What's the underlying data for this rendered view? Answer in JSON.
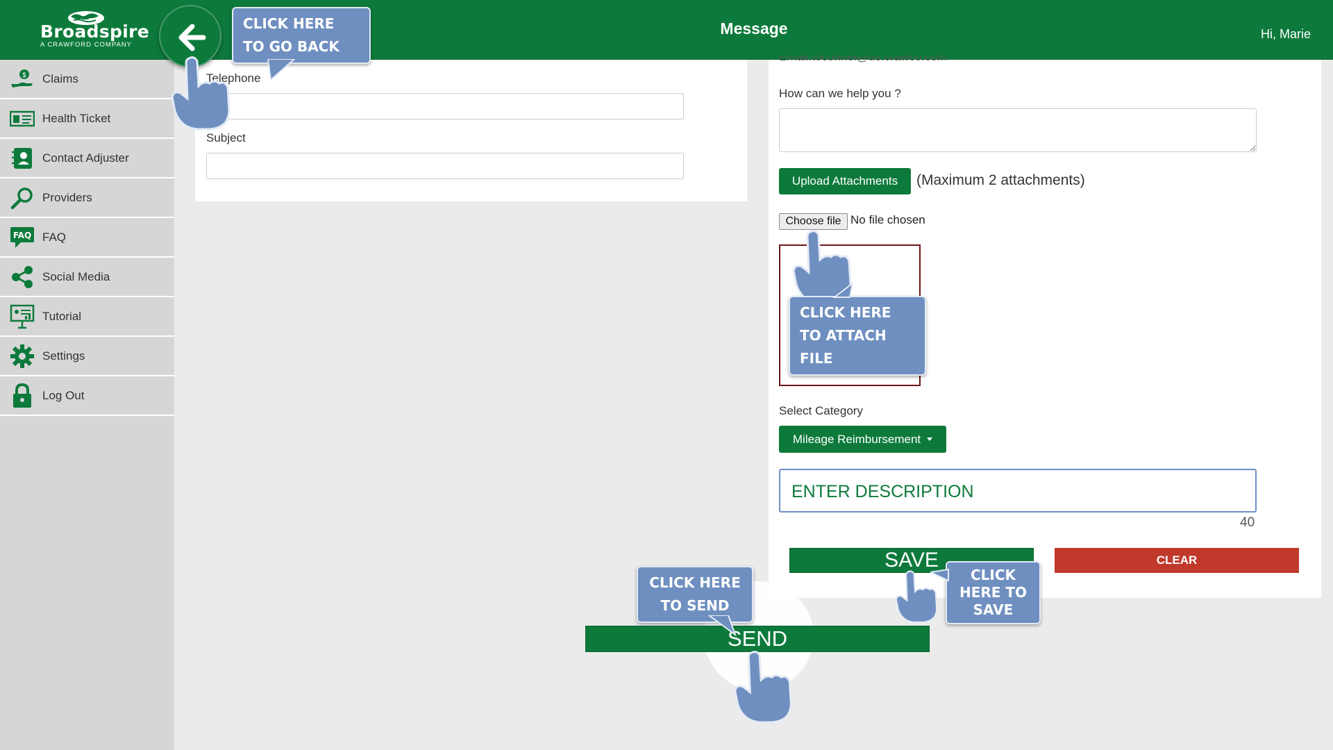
{
  "header": {
    "title": "Message",
    "greeting": "Hi, Marie",
    "brand_color": "#0d7a3b"
  },
  "logo": {
    "name": "Broadspire",
    "tagline": "A CRAWFORD COMPANY"
  },
  "sidebar": {
    "items": [
      {
        "label": "Claims",
        "icon": "hand-money-icon"
      },
      {
        "label": "Health Ticket",
        "icon": "health-ticket-icon"
      },
      {
        "label": "Contact Adjuster",
        "icon": "contact-book-icon"
      },
      {
        "label": "Providers",
        "icon": "magnifier-icon"
      },
      {
        "label": "FAQ",
        "icon": "faq-bubble-icon"
      },
      {
        "label": "Social Media",
        "icon": "share-icon"
      },
      {
        "label": "Tutorial",
        "icon": "presentation-board-icon"
      },
      {
        "label": "Settings",
        "icon": "gear-icon"
      },
      {
        "label": "Log Out",
        "icon": "padlock-icon"
      }
    ]
  },
  "form_left": {
    "telephone_label": "Telephone",
    "telephone_value": "",
    "subject_label": "Subject",
    "subject_value": ""
  },
  "form_right": {
    "email_text": "Email:toconnel@us.crawco.com",
    "help_label": "How can we help you ?",
    "help_value": "",
    "upload_label": "Upload Attachments",
    "max_attachments": "(Maximum 2 attachments)",
    "choose_file": "Choose file",
    "file_status": "No file chosen",
    "category_label": "Select Category",
    "category_selected": "Mileage Reimbursement",
    "description_placeholder": "ENTER DESCRIPTION",
    "char_counter": "40",
    "save_label": "SAVE",
    "clear_label": "CLEAR",
    "send_label": "SEND",
    "clear_color": "#c0392b"
  },
  "callouts": {
    "back": "CLICK HERE TO GO BACK",
    "attach": "CLICK HERE TO ATTACH FILE",
    "save": "CLICK HERE TO SAVE",
    "send": "CLICK HERE TO SEND"
  }
}
